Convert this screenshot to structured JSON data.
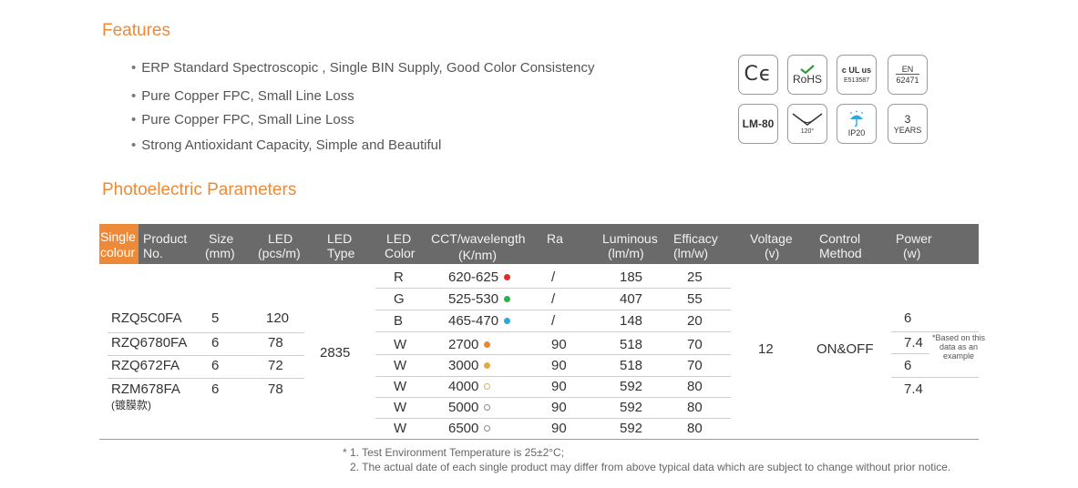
{
  "features": {
    "title": "Features",
    "items": [
      "ERP Standard  Spectroscopic , Single  BIN Supply, Good Color Consistency",
      "Pure Copper FPC, Small Line Loss",
      "Pure Copper FPC, Small Line Loss",
      "Strong Antioxidant Capacity, Simple and Beautiful"
    ]
  },
  "badges": {
    "ce": "Cϵ",
    "rohs": "RoHS",
    "ul_mark": "c UL us",
    "ul_code": "E513587",
    "en_top": "EN",
    "en_code": "62471",
    "lm80": "LM-80",
    "angle": "120°",
    "ip": "IP20",
    "warranty_num": "3",
    "warranty_unit": "YEARS"
  },
  "photoelectric": {
    "title": "Photoelectric Parameters",
    "headers": {
      "single_1": "Single",
      "single_2": "colour",
      "product_1": "Product",
      "product_2": "No.",
      "size_1": "Size",
      "size_2": "(mm)",
      "led_1": "LED",
      "led_2": "(pcs/m)",
      "ledtype_1": "LED",
      "ledtype_2": "Type",
      "ledcolor_1": "LED",
      "ledcolor_2": "Color",
      "cct_1": "CCT/wavelength",
      "cct_2": "(K/nm)",
      "ra": "Ra",
      "lum_1": "Luminous",
      "lum_2": "(lm/m)",
      "eff_1": "Efficacy",
      "eff_2": "(lm/w)",
      "volt_1": "Voltage",
      "volt_2": "(v)",
      "ctrl_1": "Control",
      "ctrl_2": "Method",
      "power_1": "Power",
      "power_2": "(w)"
    },
    "products": [
      {
        "no": "RZQ5C0FA",
        "size": "5",
        "led": "120",
        "power": "6"
      },
      {
        "no": "RZQ6780FA",
        "size": "6",
        "led": "78",
        "power": "7.4"
      },
      {
        "no": "RZQ672FA",
        "size": "6",
        "led": "72",
        "power": "6"
      },
      {
        "no": "RZM678FA",
        "size": "6",
        "led": "78",
        "power": "7.4",
        "sub": "(镀膜款)"
      }
    ],
    "led_type": "2835",
    "voltage": "12",
    "control": "ON&OFF",
    "power_note": "*Based on this data as an example",
    "colors": [
      {
        "color": "R",
        "cct": "620-625",
        "dot": "#e02b2b",
        "hollow": false,
        "ra": "/",
        "lum": "185",
        "eff": "25"
      },
      {
        "color": "G",
        "cct": "525-530",
        "dot": "#2bb24c",
        "hollow": false,
        "ra": "/",
        "lum": "407",
        "eff": "55"
      },
      {
        "color": "B",
        "cct": "465-470",
        "dot": "#2aa9e0",
        "hollow": false,
        "ra": "/",
        "lum": "148",
        "eff": "20"
      },
      {
        "color": "W",
        "cct": "2700",
        "dot": "#e8872f",
        "hollow": false,
        "ra": "90",
        "lum": "518",
        "eff": "70"
      },
      {
        "color": "W",
        "cct": "3000",
        "dot": "#e6a93a",
        "hollow": false,
        "ra": "90",
        "lum": "518",
        "eff": "70"
      },
      {
        "color": "W",
        "cct": "4000",
        "dot": "#c9b770",
        "hollow": true,
        "ra": "90",
        "lum": "592",
        "eff": "80"
      },
      {
        "color": "W",
        "cct": "5000",
        "dot": "#8a8a8a",
        "hollow": true,
        "ra": "90",
        "lum": "592",
        "eff": "80"
      },
      {
        "color": "W",
        "cct": "6500",
        "dot": "#8a8a8a",
        "hollow": true,
        "ra": "90",
        "lum": "592",
        "eff": "80"
      }
    ],
    "notes": [
      "* 1. Test Environment Temperature is 25±2°C;",
      "2. The actual date of each single product may differ from  above  typical data which are subject to change without prior notice."
    ]
  },
  "theme": {
    "accent": "#ee8a37",
    "header_bg": "#6a6a6a"
  }
}
